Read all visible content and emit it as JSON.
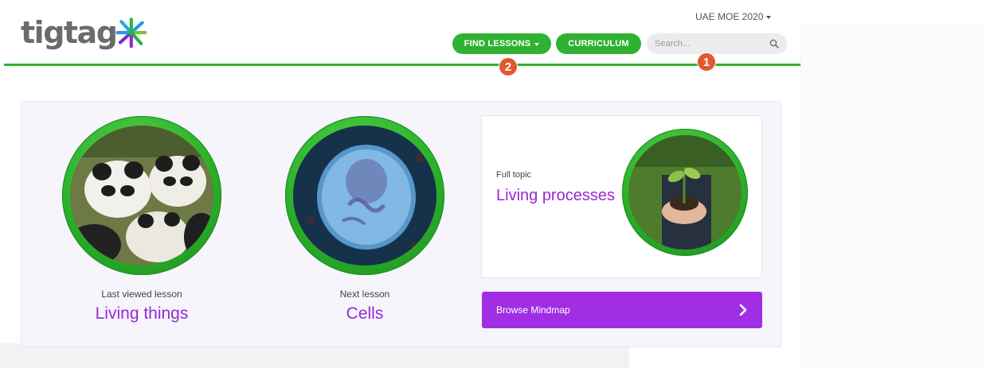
{
  "header": {
    "logo_text": "tigtag",
    "region": "UAE MOE 2020",
    "nav": {
      "find_lessons": "FIND LESSONS",
      "curriculum": "CURRICULUM"
    },
    "search": {
      "placeholder": "Search..."
    },
    "badges": {
      "nav_badge": "2",
      "search_badge": "1"
    }
  },
  "colors": {
    "brand_green": "#2fb232",
    "accent_purple": "#9b27d6",
    "button_purple": "#a12ee3",
    "badge_orange": "#e4572e"
  },
  "last_viewed": {
    "label": "Last viewed lesson",
    "title": "Living things",
    "image": "pandas"
  },
  "next_lesson": {
    "label": "Next lesson",
    "title": "Cells",
    "image": "cell"
  },
  "full_topic": {
    "label": "Full topic",
    "title": "Living processes",
    "image": "seedling-in-hands"
  },
  "mindmap": {
    "label": "Browse Mindmap",
    "icon": "chevron-right-icon"
  }
}
